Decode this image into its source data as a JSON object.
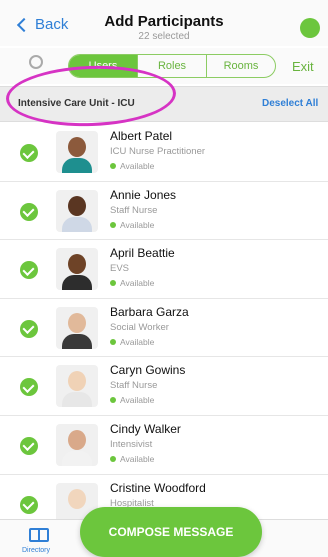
{
  "header": {
    "back_label": "Back",
    "title": "Add Participants",
    "subtitle": "22 selected"
  },
  "segments": {
    "items": [
      "Users",
      "Roles",
      "Rooms"
    ],
    "selected": "Users"
  },
  "exit_label": "Exit",
  "section": {
    "title": "Intensive Care Unit - ICU",
    "deselect_label": "Deselect All"
  },
  "participants": [
    {
      "name": "Albert Patel",
      "role": "ICU Nurse Practitioner",
      "status": "Available",
      "skin": "#8c5a3c",
      "shirt": "#1e8f8f"
    },
    {
      "name": "Annie Jones",
      "role": "Staff Nurse",
      "status": "Available",
      "skin": "#5a3622",
      "shirt": "#cfd8e6"
    },
    {
      "name": "April Beattie",
      "role": "EVS",
      "status": "Available",
      "skin": "#6e4327",
      "shirt": "#2d2d2d"
    },
    {
      "name": "Barbara Garza",
      "role": "Social Worker",
      "status": "Available",
      "skin": "#e1b99a",
      "shirt": "#3a3a3a"
    },
    {
      "name": "Caryn Gowins",
      "role": "Staff Nurse",
      "status": "Available",
      "skin": "#f0d2b6",
      "shirt": "#e7e7e7"
    },
    {
      "name": "Cindy Walker",
      "role": "Intensivist",
      "status": "Available",
      "skin": "#d9a98a",
      "shirt": "#f2f2f2"
    },
    {
      "name": "Cristine Woodford",
      "role": "Hospitalist",
      "status": "",
      "skin": "#f1d6bd",
      "shirt": "#f0f0f0"
    }
  ],
  "compose_label": "COMPOSE MESSAGE",
  "tabbar": {
    "directory_label": "Directory"
  },
  "colors": {
    "accent_green": "#6cc63d",
    "link_blue": "#2f7fd6",
    "highlight_magenta": "#d633c4"
  },
  "icons": [
    "back-chevron-icon",
    "search-icon",
    "checkmark-icon",
    "directory-icon"
  ]
}
